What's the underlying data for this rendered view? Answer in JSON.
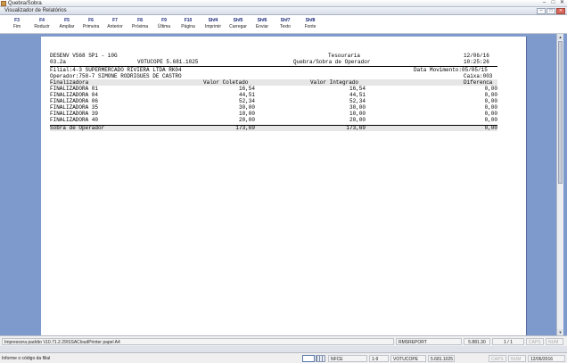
{
  "window": {
    "title": "Quebra/Sobra"
  },
  "viewer_window": {
    "title": "Visualizador de Relatórios"
  },
  "toolbar": [
    {
      "key": "F3",
      "label": "Fim"
    },
    {
      "key": "F4",
      "label": "Reduzir"
    },
    {
      "key": "F5",
      "label": "Ampliar"
    },
    {
      "key": "F6",
      "label": "Primeira"
    },
    {
      "key": "F7",
      "label": "Anterior"
    },
    {
      "key": "F8",
      "label": "Próxima"
    },
    {
      "key": "F9",
      "label": "Última"
    },
    {
      "key": "F10",
      "label": "Página"
    },
    {
      "key": "Shf4",
      "label": "Imprimir"
    },
    {
      "key": "Shf5",
      "label": "Carregar"
    },
    {
      "key": "Shf6",
      "label": "Enviar"
    },
    {
      "key": "Shf7",
      "label": "Texto"
    },
    {
      "key": "Shf8",
      "label": "Fonte"
    }
  ],
  "report": {
    "h1_left": "DESENV V568 SP1 - 10G",
    "h1_center": "Tesouraria",
    "h1_right": "12/06/16",
    "h2_left": "03.2a",
    "h2_code": "VOTUCOPE 5.681.1025",
    "h2_center": "Quebra/Sobra de Operador",
    "h2_right": "10:25:26",
    "filial": "Filial:4-3 SUPERMERCADO RIVIERA LTDA RK04",
    "data_movimento": "Data Movimento:05/05/15",
    "operador": "Operador:758-7 SIMONE RODRIGUES DE CASTRO",
    "caixa": "Caixa:003",
    "columns": [
      "Finalizadora",
      "Valor Coletado",
      "Valor Integrado",
      "Diferenca"
    ],
    "rows": [
      [
        "FINALIZADORA 01",
        "16,54",
        "16,54",
        "0,00"
      ],
      [
        "FINALIZADORA 04",
        "44,51",
        "44,51",
        "0,00"
      ],
      [
        "FINALIZADORA 06",
        "52,34",
        "52,34",
        "0,00"
      ],
      [
        "FINALIZADORA 35",
        "30,00",
        "30,00",
        "0,00"
      ],
      [
        "FINALIZADORA 39",
        "10,00",
        "10,00",
        "0,00"
      ],
      [
        "FINALIZADORA 40",
        "20,00",
        "20,00",
        "0,00"
      ]
    ],
    "total": [
      "Sobra de Operador",
      "173,69",
      "173,69",
      "0,00"
    ]
  },
  "status_bar": {
    "printer": "Impressora padrão \\\\10.71.2.29\\SSACloudPrinter papel A4",
    "report_name": "RMSREPORT",
    "version": "5.881.30",
    "pages": "1 / 1",
    "caps": "CAPS",
    "num": "NUM"
  },
  "app_status": {
    "hint": "Informe o código da filial",
    "module": "NFCE",
    "item": "1-9",
    "company": "VOTUCOPE",
    "version": "5.681.1025",
    "caps": "CAPS",
    "num": "NUM",
    "date": "12/06/2016"
  }
}
